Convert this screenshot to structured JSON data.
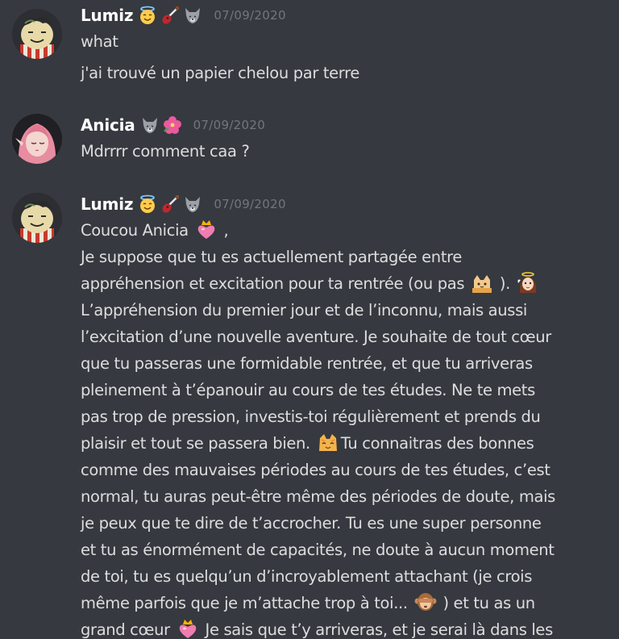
{
  "colors": {
    "background": "#36393f",
    "username": "#ffffff",
    "message_text": "#dcddde",
    "timestamp": "#72767d"
  },
  "messages": [
    {
      "username": "Lumiz",
      "badges": [
        "innocent-face-emoji",
        "guitar-emoji",
        "wolf-emoji"
      ],
      "timestamp": "07/09/2020",
      "lines": [
        "what"
      ],
      "extra_lines": [
        "j'ai trouvé un papier chelou par terre"
      ]
    },
    {
      "username": "Anicia",
      "badges": [
        "wolf-emoji",
        "hibiscus-emoji"
      ],
      "timestamp": "07/09/2020",
      "lines": [
        "Mdrrrr comment caa ?"
      ]
    },
    {
      "username": "Lumiz",
      "badges": [
        "innocent-face-emoji",
        "guitar-emoji",
        "wolf-emoji"
      ],
      "timestamp": "07/09/2020",
      "body": {
        "l1a": "Coucou Anicia",
        "l1b": " ,",
        "l2": "Je suppose que tu es actuellement partagée entre",
        "l3a": "appréhension et excitation pour ta rentrée (ou pas",
        "l3b": ").",
        "l4": "L’appréhension du premier jour et de l’inconnu, mais aussi",
        "l5": "l’excitation d’une nouvelle aventure. Je souhaite de tout cœur",
        "l6": "que tu passeras une formidable rentrée, et que tu arriveras",
        "l7": "pleinement à t’épanouir au cours de tes études. Ne te mets",
        "l8": "pas trop de pression, investis-toi régulièrement et prends du",
        "l9a": "plaisir et tout se passera bien.",
        "l9b": "Tu connaitras des bonnes",
        "l10": "comme des mauvaises périodes au cours de tes études, c’est",
        "l11": "normal, tu auras peut-être même des périodes de doute, mais",
        "l12": "je peux que te dire de t’accrocher. Tu es une super personne",
        "l13": "et tu as énormément de capacités, ne doute à aucun moment",
        "l14": "de toi, tu es quelqu’un d’incroyablement attachant (je crois",
        "l15a": "même parfois que je m’attache trop à toi...",
        "l15b": ") et tu as un",
        "l16a": "grand cœur",
        "l16b": "Je sais que t’y arriveras, et je serai là dans les"
      },
      "emojis": [
        "crowned-heart-emoji",
        "cat-peeking-emoji",
        "angel-girl-emoji",
        "happy-cat-emoji",
        "see-no-evil-monkey-emoji",
        "crowned-heart-emoji"
      ]
    }
  ]
}
